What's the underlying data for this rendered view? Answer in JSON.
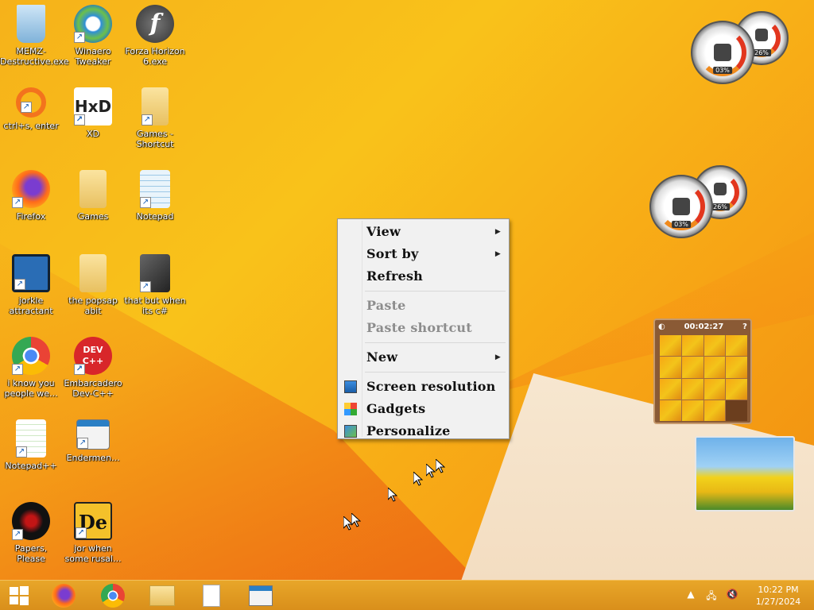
{
  "desktop": {
    "icons": [
      {
        "label": "MEMZ-Destructive.exe",
        "name": "recycle-bin-icon"
      },
      {
        "label": "Winaero Tweaker",
        "name": "winaero-tweaker-icon"
      },
      {
        "label": "Forza Horizon 6.exe",
        "name": "flash-icon"
      },
      {
        "label": "ctrl+s, enter",
        "name": "ring-icon"
      },
      {
        "label": "XD",
        "name": "hxd-icon"
      },
      {
        "label": "Games - Shortcut",
        "name": "folder-shortcut-icon"
      },
      {
        "label": "Firefox",
        "name": "firefox-icon"
      },
      {
        "label": "Games",
        "name": "folder-icon"
      },
      {
        "label": "Notepad",
        "name": "notepad-icon"
      },
      {
        "label": "jorkle attractant",
        "name": "settings-monitor-icon"
      },
      {
        "label": "the popsap abit",
        "name": "folder-icon"
      },
      {
        "label": "that but when its c#",
        "name": "stack-windows-icon"
      },
      {
        "label": "i know you people we...",
        "name": "chrome-icon"
      },
      {
        "label": "Embarcadero Dev-C++",
        "name": "devcpp-icon"
      },
      {
        "label": "Notepad++",
        "name": "notepad-plus-plus-icon"
      },
      {
        "label": "Endermen...",
        "name": "window-icon"
      },
      {
        "label": "Papers, Please",
        "name": "papers-please-icon"
      },
      {
        "label": "jor when some rusal...",
        "name": "de-icon"
      }
    ]
  },
  "gadgets": {
    "gauge1": {
      "cpu": "03%",
      "ram": "26%"
    },
    "gauge2": {
      "cpu": "03%",
      "ram": "26%"
    },
    "puzzle": {
      "timer": "00:02:27"
    }
  },
  "context_menu": {
    "view": "View",
    "sort_by": "Sort by",
    "refresh": "Refresh",
    "paste": "Paste",
    "paste_shortcut": "Paste shortcut",
    "new": "New",
    "screen_resolution": "Screen resolution",
    "gadgets": "Gadgets",
    "personalize": "Personalize"
  },
  "taskbar": {
    "time": "10:22 PM",
    "date": "1/27/2024"
  },
  "colors": {
    "wallpaper": "#f6b21a",
    "menu_bg": "#f1f1f1",
    "taskbar": "#e0991f"
  }
}
